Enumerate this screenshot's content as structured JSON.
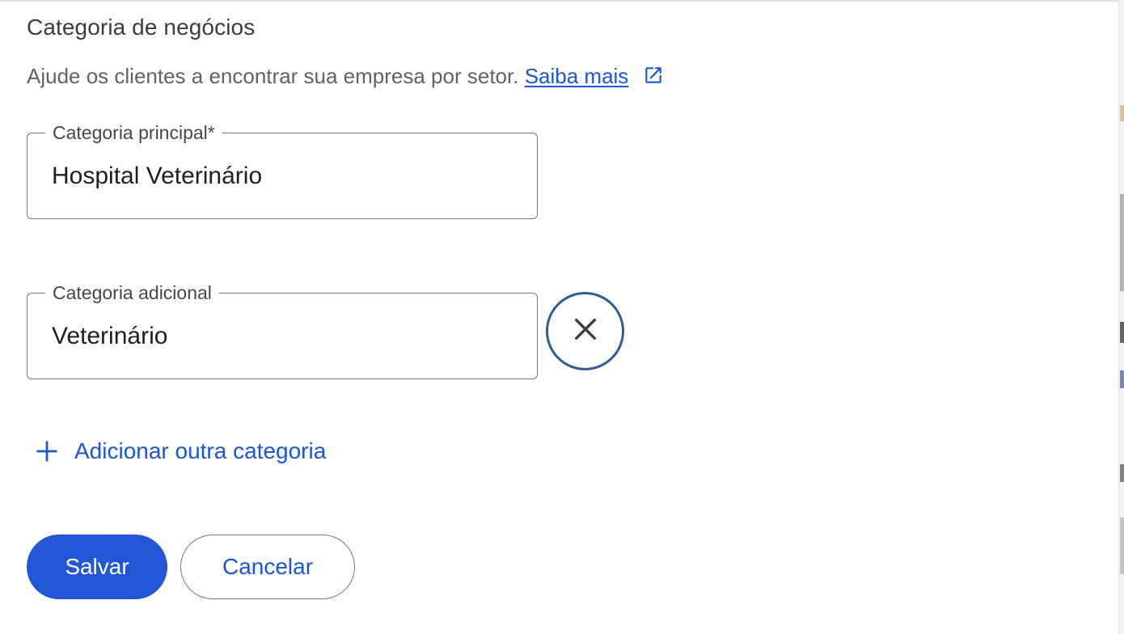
{
  "section": {
    "title": "Categoria de negócios",
    "description": "Ajude os clientes a encontrar sua empresa por setor.",
    "learn_more": "Saiba mais"
  },
  "primary_category": {
    "label": "Categoria principal*",
    "value": "Hospital Veterinário"
  },
  "additional_category": {
    "label": "Categoria adicional",
    "value": "Veterinário",
    "remove_icon": "close-icon"
  },
  "add_category": {
    "icon": "plus-icon",
    "label": "Adicionar outra categoria"
  },
  "actions": {
    "save": "Salvar",
    "cancel": "Cancelar"
  },
  "colors": {
    "accent": "#1a56d6",
    "primary_button": "#2356d6",
    "remove_ring": "#2f5d8e",
    "outline": "#747775"
  }
}
